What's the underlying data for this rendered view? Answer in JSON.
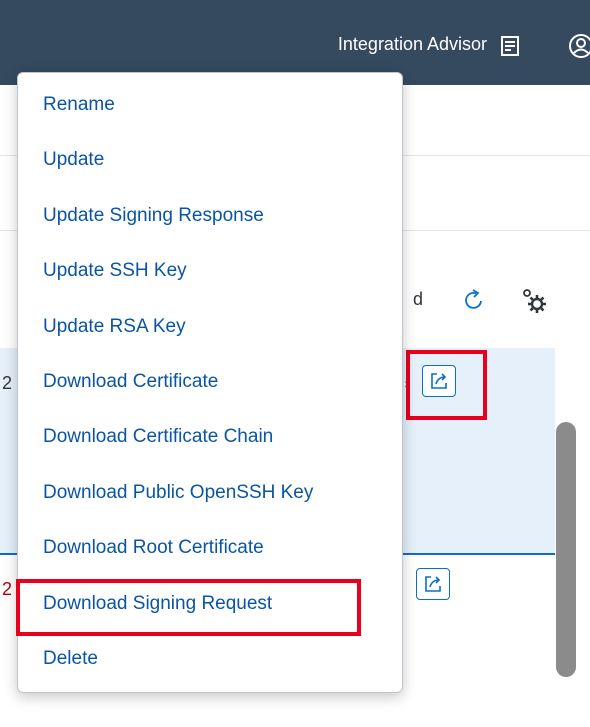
{
  "shellbar": {
    "title": "Integration Advisor",
    "notes_icon": "document-icon",
    "user_icon": "user-icon"
  },
  "toolbar": {
    "partial_label": "d",
    "refresh_icon": "refresh-icon",
    "settings_icon": "settings-icon"
  },
  "rows": [
    {
      "partial_text": "2",
      "action_icon": "open-external-icon"
    },
    {
      "partial_text": "2",
      "action_icon": "open-external-icon"
    }
  ],
  "menu": {
    "items": [
      {
        "label": "Rename"
      },
      {
        "label": "Update"
      },
      {
        "label": "Update Signing Response"
      },
      {
        "label": "Update SSH Key"
      },
      {
        "label": "Update RSA Key"
      },
      {
        "label": "Download Certificate"
      },
      {
        "label": "Download Certificate Chain"
      },
      {
        "label": "Download Public OpenSSH Key"
      },
      {
        "label": "Download Root Certificate"
      },
      {
        "label": "Download Signing Request"
      },
      {
        "label": "Delete"
      }
    ],
    "highlighted_item": "Download Signing Request"
  },
  "colors": {
    "shellbar": "#354a5f",
    "menu_text": "#0a55a3",
    "highlight": "#e8001c",
    "selected_row": "#e5f0fa"
  }
}
